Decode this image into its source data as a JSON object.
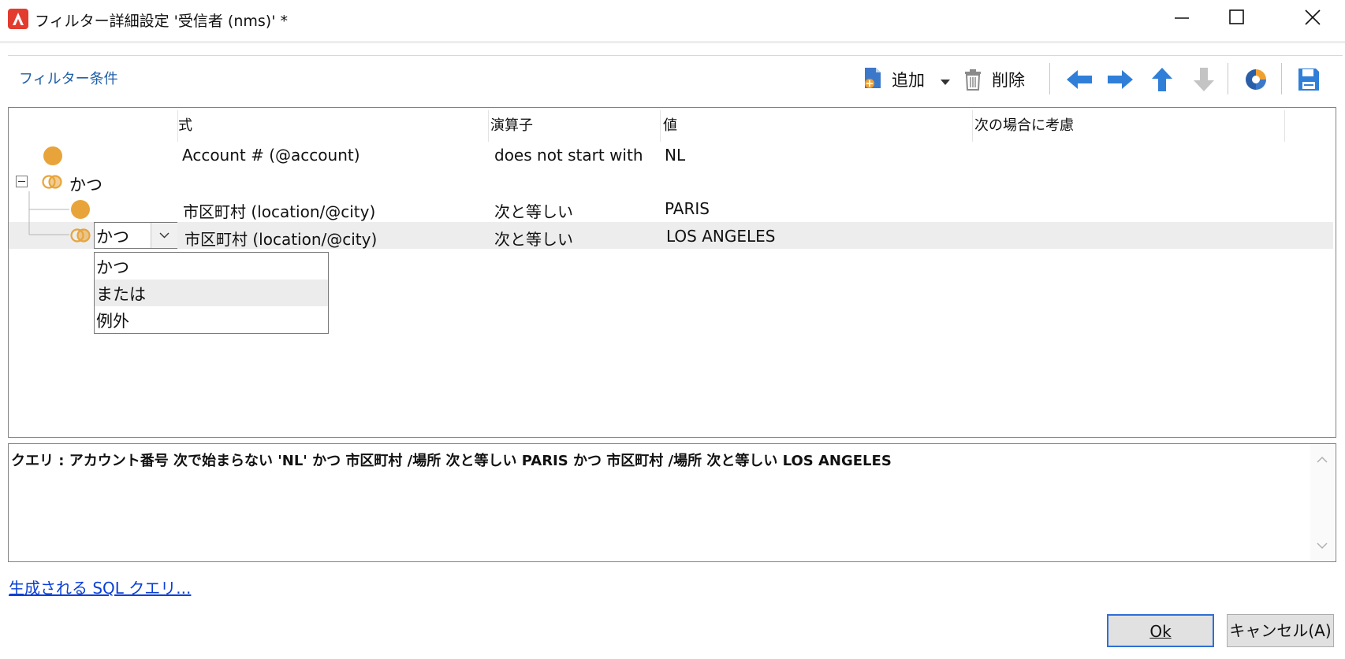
{
  "window": {
    "title": "フィルター詳細設定 '受信者 (nms)' *"
  },
  "toolbar": {
    "filter_conditions_label": "フィルター条件",
    "add_label": "追加",
    "delete_label": "削除",
    "icons": [
      "add-icon",
      "dropdown-arrow-icon",
      "trash-icon",
      "arrow-left-icon",
      "arrow-right-icon",
      "arrow-up-icon",
      "arrow-down-icon",
      "distribution-icon",
      "save-icon"
    ]
  },
  "grid": {
    "columns": [
      "式",
      "演算子",
      "値",
      "次の場合に考慮"
    ],
    "rows": [
      {
        "expression": "Account # (@account)",
        "operator": "does not start with",
        "value": "NL"
      },
      {
        "group_label": "かつ"
      },
      {
        "expression": "市区町村 (location/@city)",
        "operator": "次と等しい",
        "value": "PARIS"
      },
      {
        "expression": "市区町村 (location/@city)",
        "operator": "次と等しい",
        "value": "LOS ANGELES",
        "selected": true
      }
    ],
    "combo": {
      "value": "かつ",
      "options": [
        "かつ",
        "または",
        "例外"
      ],
      "hovered_index": 1
    }
  },
  "query": {
    "text": "クエリ : アカウント番号 次で始まらない 'NL' かつ 市区町村 /場所 次と等しい PARIS かつ 市区町村 /場所 次と等しい LOS ANGELES"
  },
  "sql_link": "生成される SQL クエリ...",
  "buttons": {
    "ok": "Ok",
    "cancel": "キャンセル(A)"
  },
  "colors": {
    "node_orange": "#e8a43a",
    "link_blue": "#0a3fd6",
    "arrow_blue": "#2f7fd8",
    "app_red": "#e33b2e"
  }
}
